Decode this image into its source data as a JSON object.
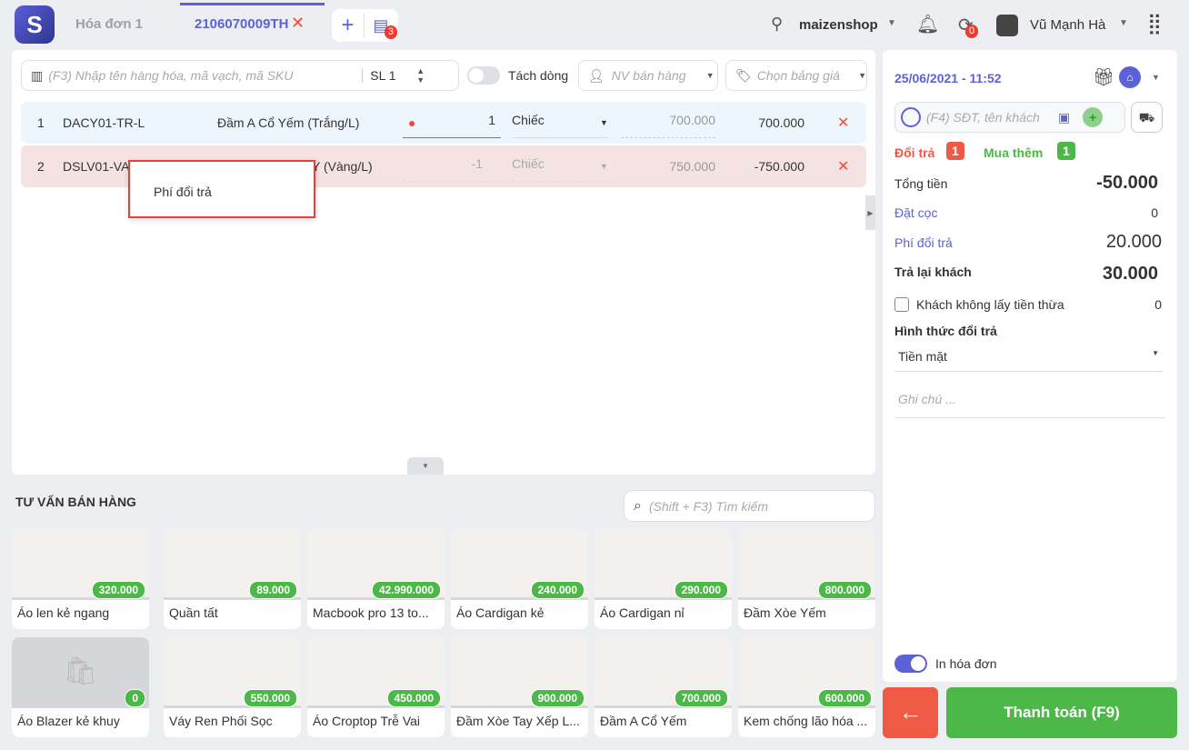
{
  "header": {
    "tab1": "Hóa đơn 1",
    "tab2": "2106070009TH",
    "orders_badge": "3",
    "store": "maizenshop",
    "sync_badge": "0",
    "user": "Vũ Mạnh Hà"
  },
  "toolbar": {
    "search_placeholder": "(F3) Nhập tên hàng hóa, mã vạch, mã SKU",
    "qty": "SL 1",
    "split_label": "Tách dòng",
    "staff_placeholder": "NV bán hàng",
    "pricelist_placeholder": "Chọn bảng giá"
  },
  "rows": [
    {
      "index": "1",
      "sku": "DACY01-TR-L",
      "name": "Đầm A Cổ Yếm (Trắng/L)",
      "qty": "1",
      "unit": "Chiếc",
      "price": "700.000",
      "total": "700.000"
    },
    {
      "index": "2",
      "sku": "DSLV01-VA",
      "name": "Y (Vàng/L)",
      "qty": "-1",
      "unit": "Chiếc",
      "price": "750.000",
      "total": "-750.000"
    }
  ],
  "popup": {
    "item": "Phí đổi trả"
  },
  "suggest": {
    "title": "TƯ VẤN BÁN HÀNG",
    "search_placeholder": "(Shift + F3) Tìm kiếm"
  },
  "products": [
    {
      "name": "Áo len kẻ ngang",
      "price": "320.000"
    },
    {
      "name": "Quần tất",
      "price": "89.000"
    },
    {
      "name": "Macbook pro 13 to...",
      "price": "42.990.000"
    },
    {
      "name": "Áo Cardigan kẻ",
      "price": "240.000"
    },
    {
      "name": "Áo Cardigan nỉ",
      "price": "290.000"
    },
    {
      "name": "Đầm Xòe Yếm",
      "price": "800.000"
    },
    {
      "name": "Áo Blazer kẻ khuy",
      "price": "0"
    },
    {
      "name": "Váy Ren Phối Sọc",
      "price": "550.000"
    },
    {
      "name": "Áo Croptop Trễ Vai",
      "price": "450.000"
    },
    {
      "name": "Đầm Xòe Tay Xếp L...",
      "price": "900.000"
    },
    {
      "name": "Đầm A Cổ Yếm",
      "price": "700.000"
    },
    {
      "name": "Kem chống lão hóa ...",
      "price": "600.000"
    }
  ],
  "right": {
    "datetime": "25/06/2021 - 11:52",
    "customer_placeholder": "(F4) SĐT, tên khách",
    "return_label": "Đổi trả",
    "return_count": "1",
    "buy_label": "Mua thêm",
    "buy_count": "1",
    "total_label": "Tổng tiền",
    "total": "-50.000",
    "deposit_label": "Đặt cọc",
    "deposit": "0",
    "fee_label": "Phí đổi trả",
    "fee": "20.000",
    "refund_label": "Trả lại khách",
    "refund": "30.000",
    "nochange_label": "Khách không lấy tiền thừa",
    "nochange": "0",
    "method_label": "Hình thức đổi trả",
    "method": "Tiền mặt",
    "note_placeholder": "Ghi chú ...",
    "print_label": "In hóa đơn",
    "pay_button": "Thanh toán (F9)"
  }
}
